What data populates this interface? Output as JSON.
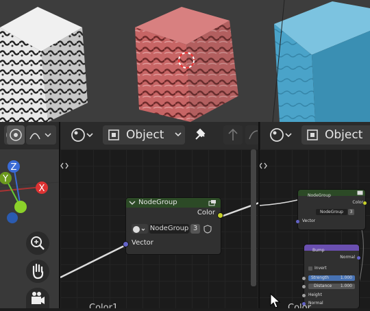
{
  "header": {
    "editor_type_left": "Object",
    "editor_type_right": "Object"
  },
  "node_group_main": {
    "title": "NodeGroup",
    "output_label": "Color",
    "group_name": "NodeGroup",
    "user_count": "3",
    "input_label": "Vector"
  },
  "node_group_small": {
    "title": "NodeGroup",
    "output_label": "Color",
    "group_name": "NodeGroup",
    "user_count": "3",
    "input_label": "Vector"
  },
  "bump_node": {
    "title": "Bump",
    "output_label": "Normal",
    "invert_label": "Invert",
    "strength_label": "Strength",
    "strength_value": "1.000",
    "distance_label": "Distance",
    "distance_value": "1.000",
    "height_label": "Height",
    "normal_label": "Normal"
  },
  "gizmo": {
    "x_label": "X",
    "y_label": "Y",
    "z_label": "Z"
  },
  "frame_labels": {
    "left": "Color1",
    "right": "Color"
  },
  "colors": {
    "node_header": "#2c4a26",
    "bump_header": "#6a4fb0",
    "socket_color": "#c7d12a",
    "socket_vector": "#6363c7",
    "cube_red": "#c45a5a",
    "cube_blue": "#4aa3c9"
  }
}
